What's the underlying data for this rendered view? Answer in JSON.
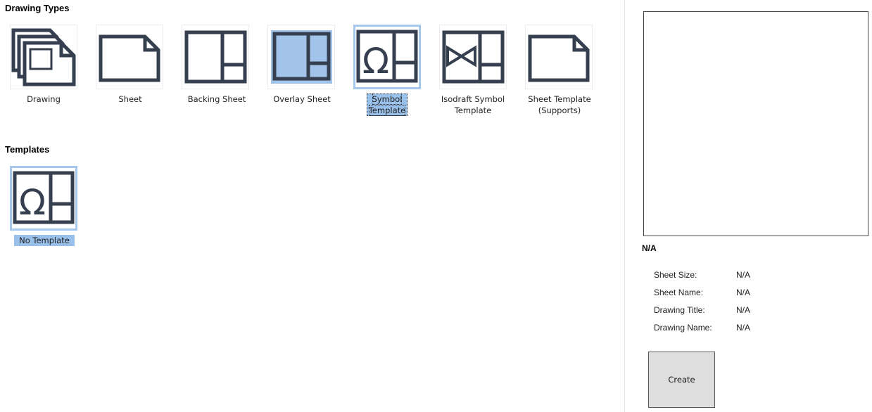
{
  "drawing_types": {
    "title": "Drawing Types",
    "items": [
      {
        "label_lines": [
          "Drawing"
        ],
        "icon": "drawing-stack-icon"
      },
      {
        "label_lines": [
          "Sheet"
        ],
        "icon": "sheet-icon"
      },
      {
        "label_lines": [
          "Backing Sheet"
        ],
        "icon": "backing-sheet-icon"
      },
      {
        "label_lines": [
          "Overlay Sheet"
        ],
        "icon": "overlay-sheet-icon"
      },
      {
        "label_lines": [
          "Symbol",
          "Template"
        ],
        "icon": "symbol-template-icon"
      },
      {
        "label_lines": [
          "Isodraft Symbol",
          "Template"
        ],
        "icon": "isodraft-symbol-icon"
      },
      {
        "label_lines": [
          "Sheet Template",
          "(Supports)"
        ],
        "icon": "sheet-template-icon"
      }
    ],
    "selected": "Symbol Template"
  },
  "templates": {
    "title": "Templates",
    "items": [
      {
        "label": "No Template",
        "icon": "symbol-template-icon"
      }
    ]
  },
  "preview": {
    "title": "N/A",
    "fields": [
      {
        "label": "Sheet Size:",
        "value": "N/A"
      },
      {
        "label": "Sheet Name:",
        "value": "N/A"
      },
      {
        "label": "Drawing Title:",
        "value": "N/A"
      },
      {
        "label": "Drawing Name:",
        "value": "N/A"
      }
    ]
  },
  "actions": {
    "create_label": "Create"
  },
  "colors": {
    "icon_stroke": "#353f4f",
    "selection_fill": "#99c0ea",
    "selection_border": "#a6c8ec",
    "overlay_fill": "#a3c4ea"
  }
}
